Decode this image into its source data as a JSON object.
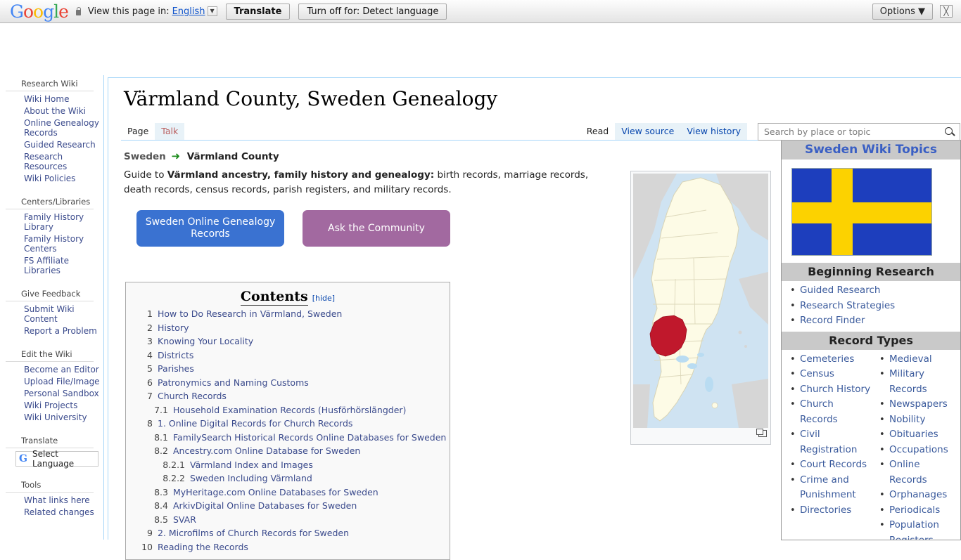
{
  "translate_bar": {
    "logo": "Google",
    "lock_icon": "lock-icon",
    "prompt": "View this page in:",
    "language": "English",
    "translate_button": "Translate",
    "turn_off_button": "Turn off for: Detect language",
    "options_button": "Options ▼",
    "close_icon": "☒"
  },
  "sidebar": {
    "sections": [
      {
        "heading": "Research Wiki",
        "items": [
          "Wiki Home",
          "About the Wiki",
          "Online Genealogy Records",
          "Guided Research",
          "Research Resources",
          "Wiki Policies"
        ]
      },
      {
        "heading": "Centers/Libraries",
        "items": [
          "Family History Library",
          "Family History Centers",
          "FS Affiliate Libraries"
        ]
      },
      {
        "heading": "Give Feedback",
        "items": [
          "Submit Wiki Content",
          "Report a Problem"
        ]
      },
      {
        "heading": "Edit the Wiki",
        "items": [
          "Become an Editor",
          "Upload File/Image",
          "Personal Sandbox",
          "Wiki Projects",
          "Wiki University"
        ]
      },
      {
        "heading": "Translate",
        "items": []
      },
      {
        "heading": "Tools",
        "items": [
          "What links here",
          "Related changes"
        ]
      }
    ],
    "language_widget": {
      "logo": "G",
      "label": "Select Language"
    }
  },
  "page": {
    "title": "Värmland County, Sweden Genealogy",
    "tabs_left": [
      {
        "label": "Page",
        "state": "selected"
      },
      {
        "label": "Talk",
        "state": "redlink"
      }
    ],
    "tabs_right": [
      {
        "label": "Read",
        "state": "selected"
      },
      {
        "label": "View source",
        "state": "shaded"
      },
      {
        "label": "View history",
        "state": "shaded"
      }
    ],
    "search": {
      "placeholder": "Search by place or topic",
      "value": "",
      "icon": "search-icon"
    },
    "breadcrumb": {
      "arrow": "➜",
      "current": "Värmland County"
    },
    "lede": {
      "prefix": "Guide to ",
      "bold": "Värmland ancestry, family history and genealogy:",
      "suffix": " birth records, marriage records, death records, census records, parish registers, and military records."
    },
    "buttons": [
      {
        "label": "Sweden Online Genealogy Records",
        "color": "#3a72d1"
      },
      {
        "label": "Ask the Community",
        "color": "#a269a0"
      }
    ],
    "toc": {
      "title": "Contents",
      "hide_label": "[hide]",
      "entries": [
        {
          "num": "1",
          "text": "How to Do Research in Värmland, Sweden",
          "level": 1
        },
        {
          "num": "2",
          "text": "History",
          "level": 1
        },
        {
          "num": "3",
          "text": "Knowing Your Locality",
          "level": 1
        },
        {
          "num": "4",
          "text": "Districts",
          "level": 1
        },
        {
          "num": "5",
          "text": "Parishes",
          "level": 1
        },
        {
          "num": "6",
          "text": "Patronymics and Naming Customs",
          "level": 1
        },
        {
          "num": "7",
          "text": "Church Records",
          "level": 1
        },
        {
          "num": "7.1",
          "text": "Household Examination Records (Husförhörslängder)",
          "level": 2
        },
        {
          "num": "8",
          "text": "1. Online Digital Records for Church Records",
          "level": 1
        },
        {
          "num": "8.1",
          "text": "FamilySearch Historical Records Online Databases for Sweden",
          "level": 2
        },
        {
          "num": "8.2",
          "text": "Ancestry.com Online Database for Sweden",
          "level": 2
        },
        {
          "num": "8.2.1",
          "text": "Värmland Index and Images",
          "level": 3
        },
        {
          "num": "8.2.2",
          "text": "Sweden Including Värmland",
          "level": 3
        },
        {
          "num": "8.3",
          "text": "MyHeritage.com Online Databases for Sweden",
          "level": 2
        },
        {
          "num": "8.4",
          "text": "ArkivDigital Online Databases for Sweden",
          "level": 2
        },
        {
          "num": "8.5",
          "text": "SVAR",
          "level": 2
        },
        {
          "num": "9",
          "text": "2. Microfilms of Church Records for Sweden",
          "level": 1
        },
        {
          "num": "10",
          "text": "Reading the Records",
          "level": 1
        }
      ]
    },
    "map": {
      "alt": "Map of Sweden with Värmland County highlighted",
      "highlight_color": "#c0182c",
      "land_color": "#fdfbe6",
      "sea_color": "#cfe3f2",
      "neighbor_color": "#d4d4d4",
      "expand_icon": "expand-icon"
    }
  },
  "topics_panel": {
    "title": "Sweden Wiki Topics",
    "flag": {
      "alt": "Flag of Sweden",
      "blue": "#1d3ebd",
      "yellow": "#fcd200"
    },
    "sections": [
      {
        "heading": "Beginning Research",
        "items": [
          "Guided Research",
          "Research Strategies",
          "Record Finder"
        ]
      }
    ],
    "record_types": {
      "heading": "Record Types",
      "left": [
        "Cemeteries",
        "Census",
        "Church History",
        "Church Records",
        "Civil Registration",
        "Court Records",
        "Crime and Punishment",
        "Directories"
      ],
      "right": [
        "Medieval",
        "Military Records",
        "Newspapers",
        "Nobility",
        "Obituaries",
        "Occupations",
        "Online Records",
        "Orphanages",
        "Periodicals",
        "Population Registers"
      ]
    }
  }
}
